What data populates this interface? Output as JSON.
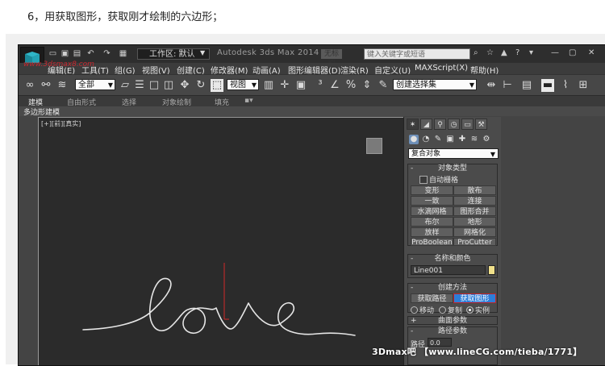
{
  "caption": "6，用获取图形，获取刚才绘制的六边形；",
  "titlebar": {
    "workspace": "工作区: 默认",
    "app_title": "Autodesk 3ds Max  2014 x64",
    "tag": "无标题",
    "search_placeholder": "键入关键字或短语"
  },
  "watermark_top": "www.3dsmax8.com",
  "menu": [
    "编辑(E)",
    "工具(T)",
    "组(G)",
    "视图(V)",
    "创建(C)",
    "修改器(M)",
    "动画(A)",
    "图形编辑器(D)",
    "渲染(R)",
    "自定义(U)",
    "MAXScript(X)",
    "帮助(H)"
  ],
  "toolbar": {
    "selection_filter": "全部",
    "ref_coord": "视图",
    "named_selection": "创建选择集"
  },
  "ribbon": {
    "tabs": [
      "建模",
      "自由形式",
      "选择",
      "对象绘制",
      "填充"
    ],
    "sub_label": "多边形建模"
  },
  "viewport": {
    "label": "[+][前][真实]",
    "handwriting": "love"
  },
  "command_panel": {
    "category": "复合对象",
    "object_type": {
      "title": "对象类型",
      "autogrid": "自动栅格",
      "buttons": [
        "变形",
        "散布",
        "一致",
        "连接",
        "水滴网格",
        "图形合并",
        "布尔",
        "地形",
        "放样",
        "网格化",
        "ProBoolean",
        "ProCutter"
      ]
    },
    "name_color": {
      "title": "名称和颜色",
      "name": "Line001"
    },
    "creation_method": {
      "title": "创建方法",
      "get_path": "获取路径",
      "get_shape": "获取图形",
      "radios": [
        "移动",
        "复制",
        "实例"
      ]
    },
    "surface_params": "曲面参数",
    "path_params": "路径参数",
    "path_label": "路径",
    "path_value": "0.0"
  },
  "footer_watermark": "3Dmax吧 【www.lineCG.com/tieba/1771】",
  "colors": {
    "accent_blue": "#2d7dd8",
    "highlight_red": "#c3232a",
    "viewport_bg": "#2b2b2b"
  }
}
